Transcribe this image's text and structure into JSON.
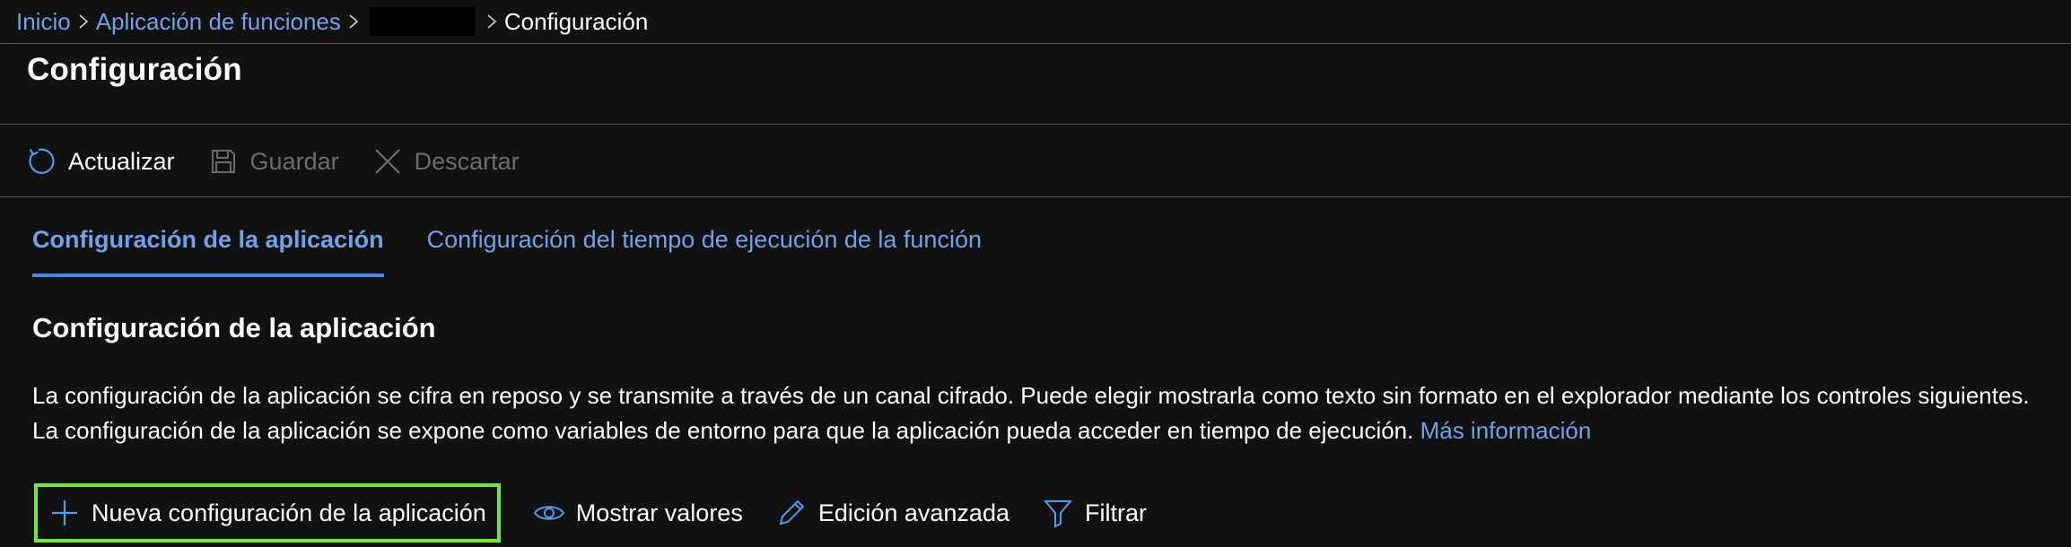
{
  "breadcrumb": {
    "home": "Inicio",
    "function_app": "Aplicación de funciones",
    "current": "Configuración"
  },
  "page": {
    "title": "Configuración"
  },
  "toolbar": {
    "refresh_label": "Actualizar",
    "save_label": "Guardar",
    "discard_label": "Descartar"
  },
  "tabs": [
    {
      "label": "Configuración de la aplicación",
      "active": true
    },
    {
      "label": "Configuración del tiempo de ejecución de la función",
      "active": false
    }
  ],
  "section": {
    "heading": "Configuración de la aplicación",
    "description": "La configuración de la aplicación se cifra en reposo y se transmite a través de un canal cifrado. Puede elegir mostrarla como texto sin formato en el explorador mediante los controles siguientes. La configuración de la aplicación se expone como variables de entorno para que la aplicación pueda acceder en tiempo de ejecución.",
    "learn_more": "Más información"
  },
  "actions": {
    "new_setting": "Nueva configuración de la aplicación",
    "show_values": "Mostrar valores",
    "advanced_edit": "Edición avanzada",
    "filter": "Filtrar"
  },
  "colors": {
    "background": "#111111",
    "link": "#6ea2ea",
    "tab_underline": "#3f8ae6",
    "highlight_border": "#6ee93c",
    "disabled": "#6b6b6b"
  },
  "icons": {
    "refresh": "refresh-icon",
    "save": "save-icon",
    "discard": "close-icon",
    "add": "plus-icon",
    "show": "eye-icon",
    "edit": "pencil-icon",
    "filter": "filter-icon"
  }
}
